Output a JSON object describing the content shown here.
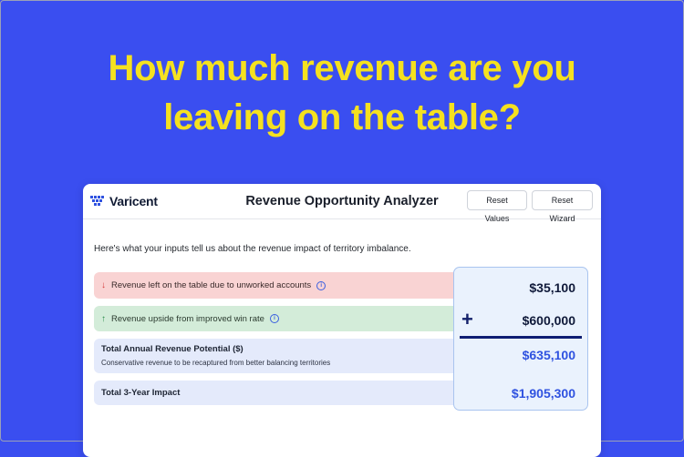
{
  "headline": {
    "line1": "How much revenue are you",
    "line2": "leaving on the table?"
  },
  "colors": {
    "background": "#3a4ef0",
    "headline": "#f5e11f",
    "accent_blue": "#2f52e0",
    "loss_row": "#f9d3d3",
    "gain_row": "#d3ecd9",
    "total_row": "#e4eafb"
  },
  "app": {
    "logo_text": "Varicent",
    "title": "Revenue Opportunity Analyzer",
    "buttons": {
      "reset_values": "Reset Values",
      "reset_wizard": "Reset Wizard"
    }
  },
  "intro": "Here's what your inputs tell us about the revenue impact of territory imbalance.",
  "rows": {
    "loss": {
      "icon": "arrow-down-icon",
      "label": "Revenue left on the table due to unworked accounts",
      "value": "$35,100"
    },
    "gain": {
      "icon": "arrow-up-icon",
      "label": "Revenue upside from improved win rate",
      "value": "$600,000"
    },
    "total": {
      "label": "Total Annual Revenue Potential ($)",
      "sublabel": "Conservative revenue to be recaptured from better balancing territories",
      "value": "$635,100"
    },
    "three_year": {
      "label": "Total 3-Year Impact",
      "value": "$1,905,300"
    }
  },
  "symbols": {
    "plus": "+",
    "arrow_down": "↓",
    "arrow_up": "↑",
    "info": "i"
  }
}
